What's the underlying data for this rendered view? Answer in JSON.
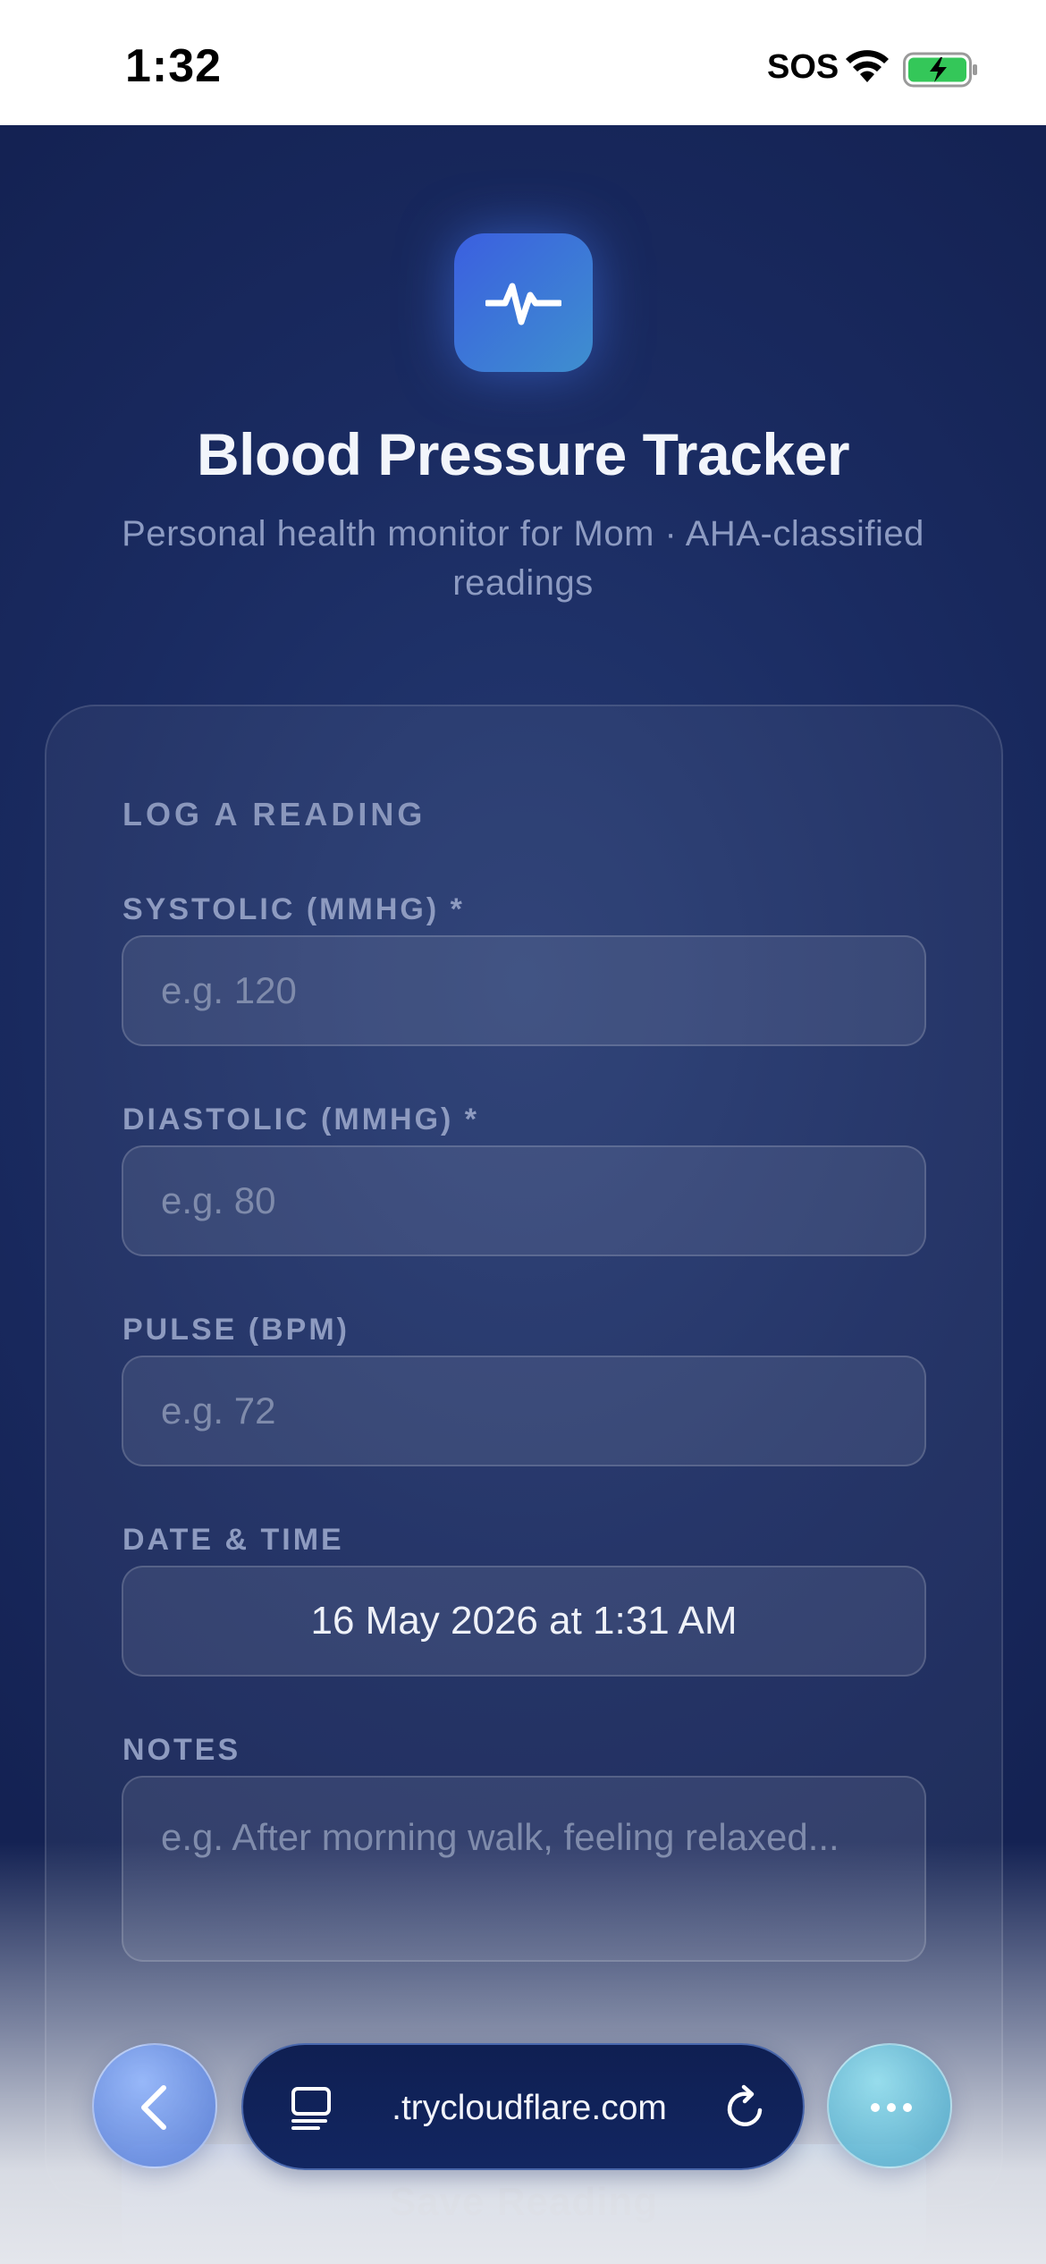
{
  "status_bar": {
    "time": "1:32",
    "sos": "SOS",
    "wifi_icon": "wifi-icon",
    "battery_icon": "battery-charging-icon"
  },
  "header": {
    "logo_icon": "heartbeat-pulse-icon",
    "title": "Blood Pressure Tracker",
    "subtitle": "Personal health monitor for Mom  ·  AHA-classified readings"
  },
  "form": {
    "heading": "LOG A READING",
    "systolic": {
      "label": "SYSTOLIC (MMHG) *",
      "placeholder": "e.g. 120",
      "value": ""
    },
    "diastolic": {
      "label": "DIASTOLIC (MMHG) *",
      "placeholder": "e.g. 80",
      "value": ""
    },
    "pulse": {
      "label": "PULSE (BPM)",
      "placeholder": "e.g. 72",
      "value": ""
    },
    "datetime": {
      "label": "DATE & TIME",
      "value": "16 May 2026 at 1:31 AM"
    },
    "notes": {
      "label": "NOTES",
      "placeholder": "e.g. After morning walk, feeling relaxed..."
    },
    "submit_label": "Save Reading"
  },
  "browser": {
    "url": ".trycloudflare.com",
    "back_icon": "chevron-left-icon",
    "tabs_icon": "tabs-icon",
    "reload_icon": "reload-icon",
    "more_icon": "more-icon"
  },
  "colors": {
    "background": "#17275a",
    "accent_start": "#3b5fe0",
    "accent_end": "#3e8fcf",
    "label": "#8e9bc0"
  }
}
